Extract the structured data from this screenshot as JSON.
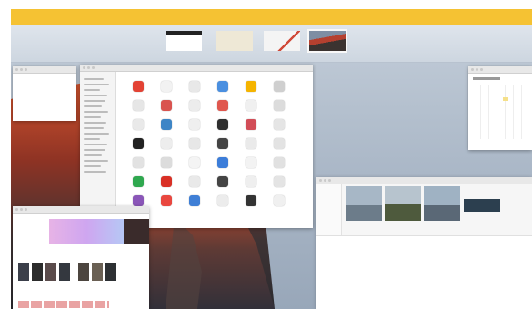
{
  "spaces": [
    {
      "label": ""
    },
    {
      "label": ""
    },
    {
      "label": ""
    },
    {
      "label": ""
    }
  ],
  "colors": {
    "top_bar": "#f5c233",
    "app_icons": [
      "#e34234",
      "#f2f2f2",
      "#e8e8e8",
      "#4a8fe0",
      "#f5b400",
      "#cfcfcf",
      "#e6e6e6",
      "#d9534f",
      "#ececec",
      "#e0574e",
      "#f0f0f0",
      "#dcdcdc",
      "#e9e9e9",
      "#3d85c6",
      "#efefef",
      "#2f2f2f",
      "#d24d57",
      "#e5e5e5",
      "#222222",
      "#ededed",
      "#e7e7e7",
      "#444444",
      "#eaeaea",
      "#e3e3e3",
      "#e2e2e2",
      "#dcdcdc",
      "#f4f4f4",
      "#3c7dd9",
      "#f3f3f3",
      "#e1e1e1",
      "#2fa84f",
      "#d93025",
      "#e9e9e9",
      "#444444",
      "#efefef",
      "#e4e4e4",
      "#8a56b8",
      "#e9473f",
      "#3f7fd6",
      "#ececec",
      "#333333",
      "#f0f0f0"
    ]
  }
}
